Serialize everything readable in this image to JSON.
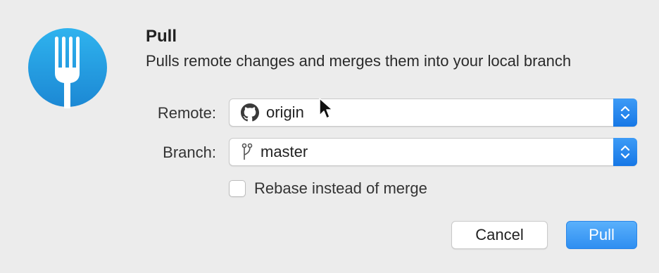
{
  "dialog": {
    "title": "Pull",
    "subtitle": "Pulls remote changes and merges them into your local branch"
  },
  "remote": {
    "label": "Remote:",
    "value": "origin",
    "icon": "github-icon"
  },
  "branch": {
    "label": "Branch:",
    "value": "master",
    "icon": "branch-icon"
  },
  "rebase": {
    "label": "Rebase instead of merge",
    "checked": false
  },
  "buttons": {
    "cancel": "Cancel",
    "pull": "Pull"
  },
  "colors": {
    "accent": "#2e8ef1",
    "icon_bg": "#1e9fe3",
    "window_bg": "#ececec"
  }
}
